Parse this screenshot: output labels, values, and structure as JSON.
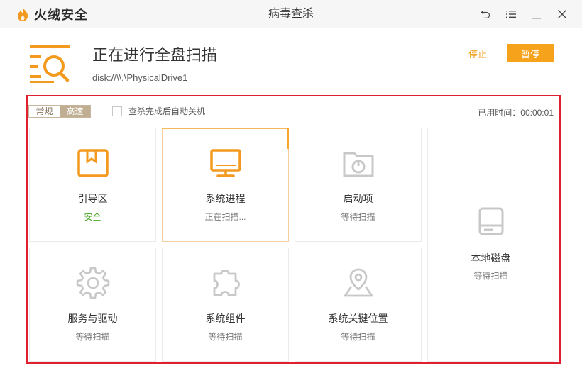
{
  "app": {
    "brand": "火绒安全",
    "window_title": "病毒查杀"
  },
  "scan": {
    "heading": "正在进行全盘扫描",
    "current_path": "disk://\\\\.\\PhysicalDrive1",
    "stop_label": "停止",
    "pause_label": "暂停"
  },
  "options": {
    "mode_normal": "常规",
    "mode_fast": "高速",
    "mode_selected": "高速",
    "auto_shutdown_label": "查杀完成后自动关机",
    "auto_shutdown_checked": false,
    "elapsed_label": "已用时间：",
    "elapsed_value": "00:00:01"
  },
  "items": [
    {
      "name": "引导区",
      "status": "安全",
      "icon": "bookmark-box-icon"
    },
    {
      "name": "系统进程",
      "status": "正在扫描...",
      "icon": "monitor-icon"
    },
    {
      "name": "启动项",
      "status": "等待扫描",
      "icon": "startup-folder-icon"
    },
    {
      "name": "本地磁盘",
      "status": "等待扫描",
      "icon": "hard-disk-icon"
    },
    {
      "name": "服务与驱动",
      "status": "等待扫描",
      "icon": "gear-icon"
    },
    {
      "name": "系统组件",
      "status": "等待扫描",
      "icon": "puzzle-icon"
    },
    {
      "name": "系统关键位置",
      "status": "等待扫描",
      "icon": "map-pin-icon"
    }
  ],
  "colors": {
    "accent": "#f7a21b",
    "highlight": "#e0202e",
    "safe": "#4ca92b",
    "idle_icon": "#c8c8c8"
  }
}
